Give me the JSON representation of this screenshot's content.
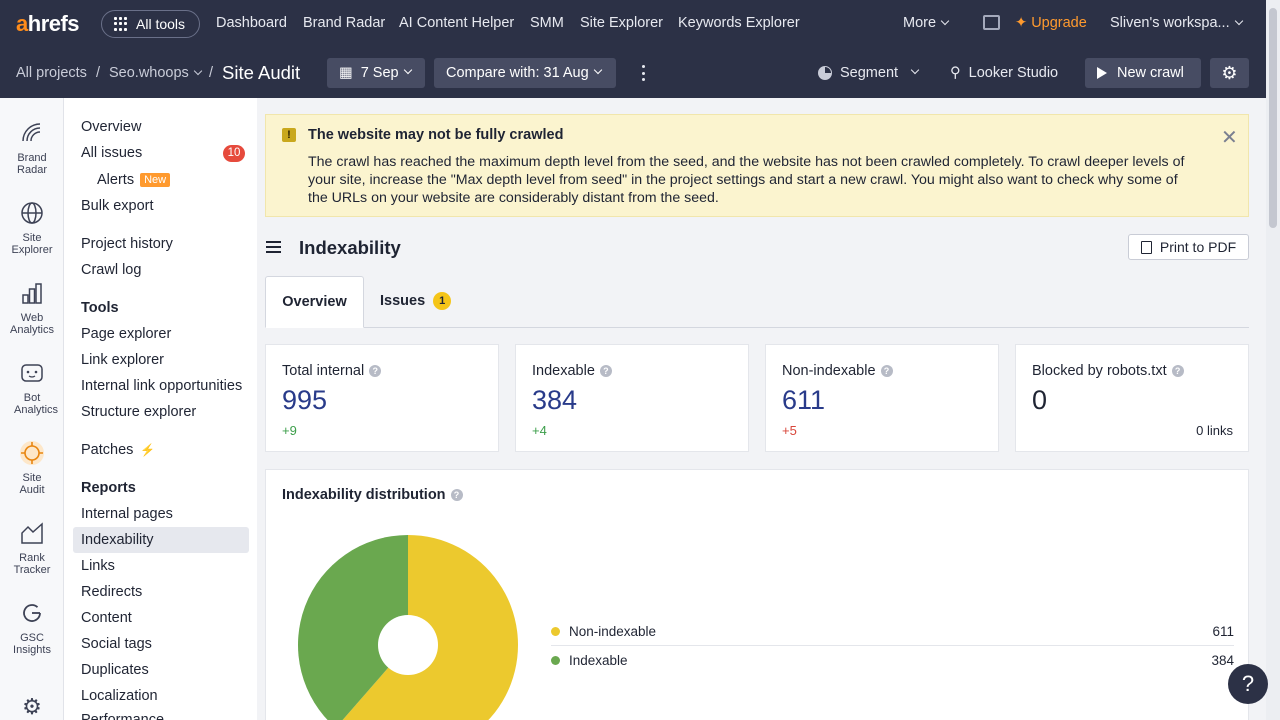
{
  "app": {
    "logo": "ahrefs",
    "all_tools": "All tools",
    "nav": [
      "Dashboard",
      "Brand Radar",
      "AI Content Helper",
      "SMM",
      "Site Explorer",
      "Keywords Explorer"
    ],
    "more": "More",
    "upgrade": "Upgrade",
    "workspace": "Sliven's workspa..."
  },
  "subbar": {
    "all_projects": "All projects",
    "sep": "/",
    "project": "Seo.whoops",
    "page_title": "Site Audit",
    "date": "7 Sep",
    "compare": "Compare with: 31 Aug",
    "segment": "Segment",
    "looker": "Looker Studio",
    "new_crawl": "New crawl"
  },
  "rail": [
    {
      "label": "Brand Radar",
      "icon": "brand-radar-icon"
    },
    {
      "label": "Site Explorer",
      "icon": "globe-icon"
    },
    {
      "label": "Web Analytics",
      "icon": "bar-chart-icon"
    },
    {
      "label": "Bot Analytics",
      "icon": "bot-icon"
    },
    {
      "label": "Site Audit",
      "icon": "site-audit-icon"
    },
    {
      "label": "Rank Tracker",
      "icon": "rank-tracker-icon"
    },
    {
      "label": "GSC Insights",
      "icon": "google-icon"
    }
  ],
  "side": {
    "overview": "Overview",
    "all_issues": "All issues",
    "all_issues_count": "10",
    "alerts": "Alerts",
    "new_badge": "New",
    "bulk_export": "Bulk export",
    "project_history": "Project history",
    "crawl_log": "Crawl log",
    "tools_head": "Tools",
    "tools": [
      "Page explorer",
      "Link explorer",
      "Internal link opportunities",
      "Structure explorer"
    ],
    "patches": "Patches",
    "reports_head": "Reports",
    "reports": [
      "Internal pages",
      "Indexability",
      "Links",
      "Redirects",
      "Content",
      "Social tags",
      "Duplicates",
      "Localization",
      "Performance"
    ]
  },
  "banner": {
    "title": "The website may not be fully crawled",
    "text": "The crawl has reached the maximum depth level from the seed, and the website has not been crawled completely. To crawl deeper levels of your site, increase the \"Max depth level from seed\" in the project settings and start a new crawl. You might also want to check why some of the URLs on your website are considerably distant from the seed.",
    "close": "✕",
    "icon": "!"
  },
  "section": {
    "title": "Indexability",
    "print": "Print to PDF",
    "tabs": {
      "overview": "Overview",
      "issues": "Issues",
      "issues_count": "1"
    }
  },
  "cards": [
    {
      "label": "Total internal",
      "value": "995",
      "delta": "+9"
    },
    {
      "label": "Indexable",
      "value": "384",
      "delta": "+4"
    },
    {
      "label": "Non-indexable",
      "value": "611",
      "delta": "+5"
    },
    {
      "label": "Blocked by robots.txt",
      "value": "0",
      "links": "0 links"
    }
  ],
  "distribution": {
    "title": "Indexability distribution",
    "items": [
      {
        "label": "Non-indexable",
        "value": "611",
        "color": "#ecc92e"
      },
      {
        "label": "Indexable",
        "value": "384",
        "color": "#6aa84f"
      }
    ]
  },
  "help_fab": "?"
}
